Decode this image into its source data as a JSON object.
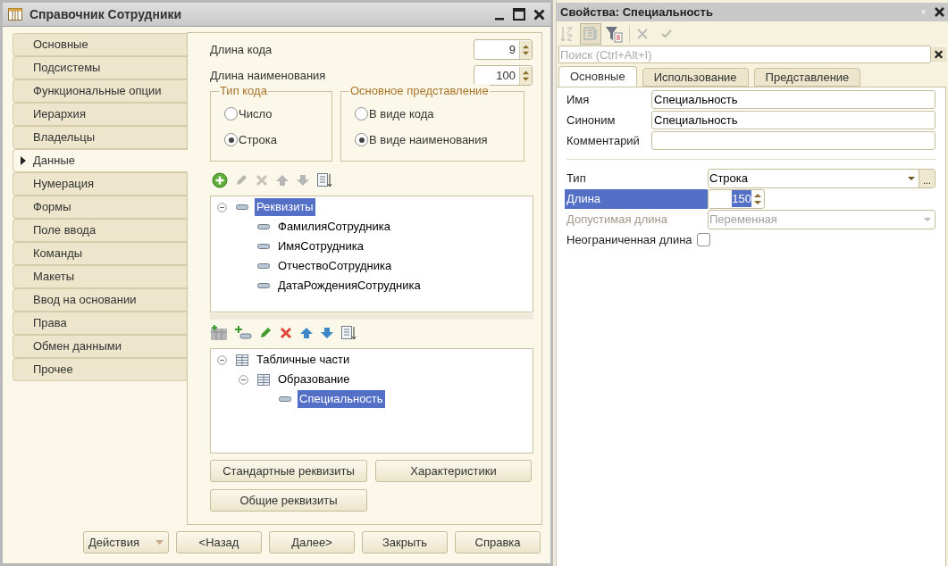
{
  "window": {
    "title": "Справочник Сотрудники"
  },
  "sections": [
    {
      "label": "Основные",
      "selected": false
    },
    {
      "label": "Подсистемы",
      "selected": false
    },
    {
      "label": "Функциональные опции",
      "selected": false
    },
    {
      "label": "Иерархия",
      "selected": false
    },
    {
      "label": "Владельцы",
      "selected": false
    },
    {
      "label": "Данные",
      "selected": true
    },
    {
      "label": "Нумерация",
      "selected": false
    },
    {
      "label": "Формы",
      "selected": false
    },
    {
      "label": "Поле ввода",
      "selected": false
    },
    {
      "label": "Команды",
      "selected": false
    },
    {
      "label": "Макеты",
      "selected": false
    },
    {
      "label": "Ввод на основании",
      "selected": false
    },
    {
      "label": "Права",
      "selected": false
    },
    {
      "label": "Обмен данными",
      "selected": false
    },
    {
      "label": "Прочее",
      "selected": false
    }
  ],
  "length_fields": [
    {
      "label": "Длина кода",
      "value": "9"
    },
    {
      "label": "Длина наименования",
      "value": "100"
    }
  ],
  "radio_groups": [
    {
      "title": "Тип кода",
      "options": [
        {
          "label": "Число",
          "selected": false
        },
        {
          "label": "Строка",
          "selected": true
        }
      ]
    },
    {
      "title": "Основное представление",
      "options": [
        {
          "label": "В виде кода",
          "selected": false
        },
        {
          "label": "В виде наименования",
          "selected": true
        }
      ]
    }
  ],
  "attributes_tree": [
    {
      "label": "Реквизиты",
      "kind": "attribute",
      "expanded": true,
      "selected": true,
      "children": [
        {
          "label": "ФамилияСотрудника",
          "kind": "attribute",
          "selected": false
        },
        {
          "label": "ИмяСотрудника",
          "kind": "attribute",
          "selected": false
        },
        {
          "label": "ОтчествоСотрудника",
          "kind": "attribute",
          "selected": false
        },
        {
          "label": "ДатаРожденияСотрудника",
          "kind": "attribute",
          "selected": false
        }
      ]
    }
  ],
  "tables_tree": [
    {
      "label": "Табличные части",
      "kind": "table",
      "expanded": true,
      "selected": false,
      "children": [
        {
          "label": "Образование",
          "kind": "table",
          "expanded": true,
          "selected": false,
          "children": [
            {
              "label": "Специальность",
              "kind": "attribute",
              "selected": true
            }
          ]
        }
      ]
    }
  ],
  "panel_buttons": [
    "Стандартные реквизиты",
    "Характеристики",
    "Общие реквизиты"
  ],
  "footer_buttons": [
    {
      "label": "Действия",
      "kind": "menu"
    },
    {
      "label": "<Назад",
      "kind": "plain"
    },
    {
      "label": "Далее>",
      "kind": "plain"
    },
    {
      "label": "Закрыть",
      "kind": "plain"
    },
    {
      "label": "Справка",
      "kind": "plain"
    }
  ],
  "properties": {
    "title": "Свойства: Специальность",
    "pin": "ᵠ",
    "search": {
      "placeholder": "Поиск (Ctrl+Alt+I)"
    },
    "tabs": [
      {
        "label": "Основные",
        "selected": true
      },
      {
        "label": "Использование",
        "selected": false
      },
      {
        "label": "Представление",
        "selected": false
      }
    ],
    "top_rows": [
      {
        "label": "Имя",
        "value": "Специальность"
      },
      {
        "label": "Синоним",
        "value": "Специальность"
      },
      {
        "label": "Комментарий"
      }
    ],
    "rows": [
      {
        "label": "Тип",
        "kind": "select",
        "value": "Строка",
        "more": "...",
        "selected": false,
        "disabled": false
      },
      {
        "label": "Длина",
        "kind": "spin",
        "value": "150",
        "selected": true,
        "disabled": false
      },
      {
        "label": "Допустимая длина",
        "kind": "dropdown",
        "value": "Переменная",
        "selected": false,
        "disabled": true
      },
      {
        "label": "Неограниченная длина",
        "kind": "checkbox",
        "checked": false,
        "selected": false,
        "disabled": false
      }
    ]
  }
}
